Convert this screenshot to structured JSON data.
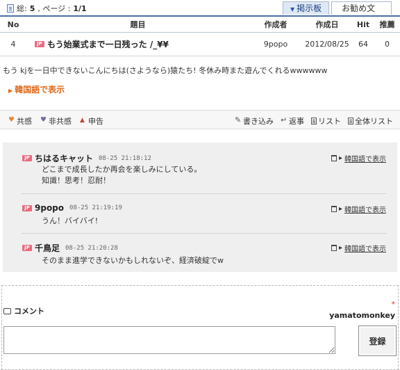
{
  "topbar": {
    "total_label": "総:",
    "total_value": "5",
    "page_label": ", ページ :",
    "page_value": "1/1",
    "tabs": [
      {
        "label": "掲示板",
        "active": true
      },
      {
        "label": "お勧め文",
        "active": false
      }
    ]
  },
  "board": {
    "columns": [
      "No",
      "題目",
      "作成者",
      "作成日",
      "Hit",
      "推薦"
    ],
    "rows": [
      {
        "no": "4",
        "badge": "JP",
        "title": "もう始業式まで一日残った /_¥¥",
        "author": "9popo",
        "date": "2012/08/25",
        "hit": "64",
        "rec": "0"
      }
    ]
  },
  "post": {
    "body": "もう kjを一日中できないこんにちは(さようなら)猿たち! 冬休み時また遊んでくれるwwwwww",
    "translate_label": "韓国語で表示"
  },
  "actions": {
    "left": [
      "共感",
      "非共感",
      "申告"
    ],
    "right": [
      "書き込み",
      "返事",
      "リスト",
      "全体リスト"
    ]
  },
  "comments": [
    {
      "badge": "JP",
      "name": "ちはるキャット",
      "time": "08-25 21:18:12",
      "lines": [
        "どこまで成長したか再会を楽しみにしている。",
        "知識！思考！忍耐！"
      ],
      "translate": "韓国語で表示"
    },
    {
      "badge": "JP",
      "name": "9popo",
      "time": "08-25 21:19:19",
      "lines": [
        "うん！バイバイ!"
      ],
      "translate": "韓国語で表示"
    },
    {
      "badge": "JP",
      "name": "千鳥足",
      "time": "08-25 21:20:28",
      "lines": [
        "そのまま進学できないかもしれないぞ、経済破綻でw"
      ],
      "translate": "韓国語で表示"
    }
  ],
  "form": {
    "title": "コメント",
    "required_mark": "*",
    "username": "yamatomonkey",
    "submit_label": "登録"
  },
  "colors": {
    "accent_blue": "#4d6fa6",
    "translate_orange": "#e06a1c",
    "jp_badge": "#e86a7e"
  }
}
